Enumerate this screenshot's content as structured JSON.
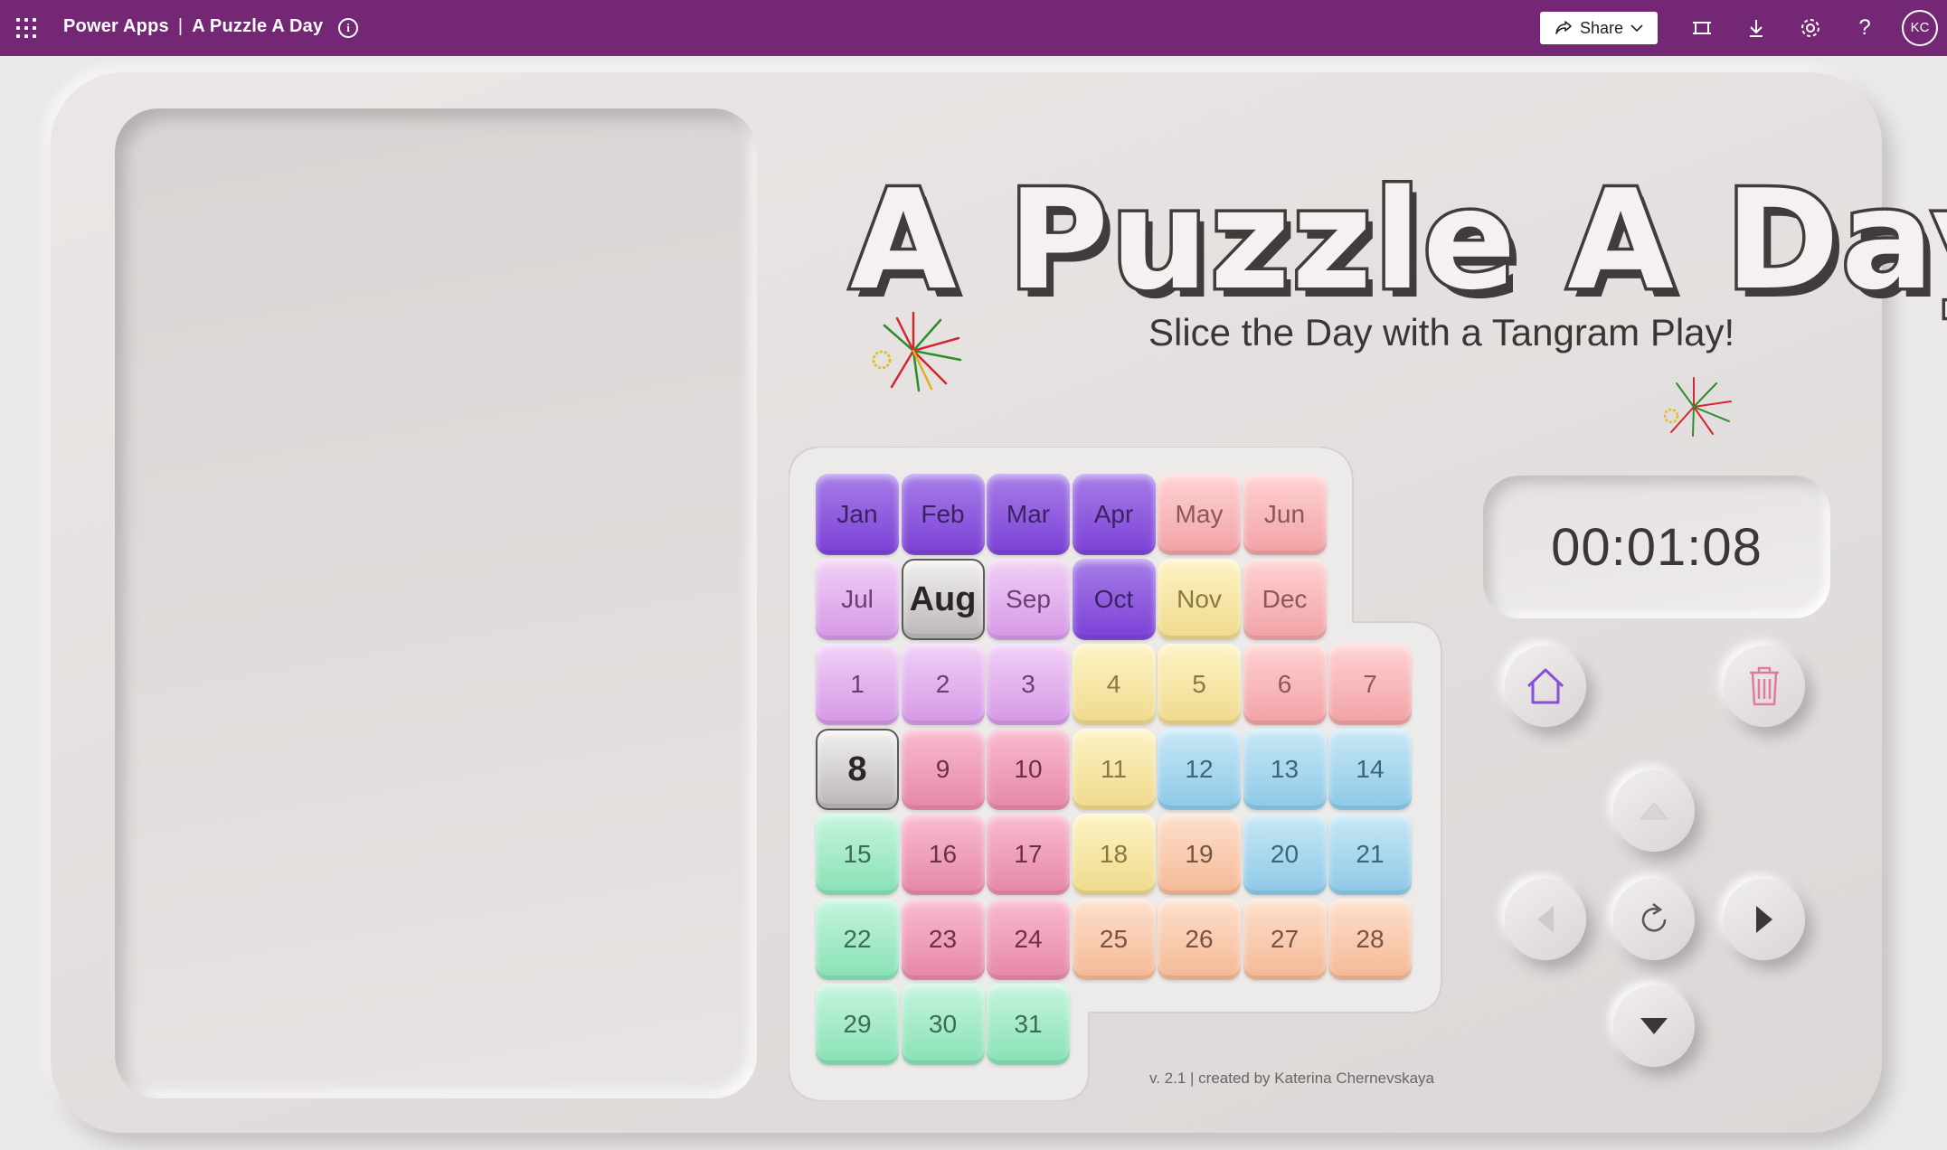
{
  "topbar": {
    "app_name": "Power Apps",
    "separator": "|",
    "app_title": "A Puzzle A Day",
    "share_label": "Share",
    "avatar_initials": "KC",
    "bg_color": "#742774",
    "icons": [
      "waffle-icon",
      "info-icon",
      "share-icon",
      "chevron-down-icon",
      "fit-to-window-icon",
      "download-icon",
      "settings-icon",
      "help-icon"
    ]
  },
  "hero": {
    "title": "A Puzzle A Day",
    "subtitle": "Slice the Day with a Tangram Play!"
  },
  "board": {
    "months": [
      "Jan",
      "Feb",
      "Mar",
      "Apr",
      "May",
      "Jun",
      "Jul",
      "Aug",
      "Sep",
      "Oct",
      "Nov",
      "Dec"
    ],
    "days": [
      "1",
      "2",
      "3",
      "4",
      "5",
      "6",
      "7",
      "8",
      "9",
      "10",
      "11",
      "12",
      "13",
      "14",
      "15",
      "16",
      "17",
      "18",
      "19",
      "20",
      "21",
      "22",
      "23",
      "24",
      "25",
      "26",
      "27",
      "28",
      "29",
      "30",
      "31"
    ],
    "selected_month": "Aug",
    "selected_day": "8"
  },
  "timer": {
    "value": "00:01:08"
  },
  "controls": {
    "icons": [
      "home-icon",
      "trash-icon",
      "arrow-up-icon",
      "arrow-left-icon",
      "rotate-icon",
      "arrow-right-icon",
      "arrow-down-icon"
    ]
  },
  "footer": {
    "version_text": "v. 2.1 | created by Katerina Chernevskaya"
  }
}
